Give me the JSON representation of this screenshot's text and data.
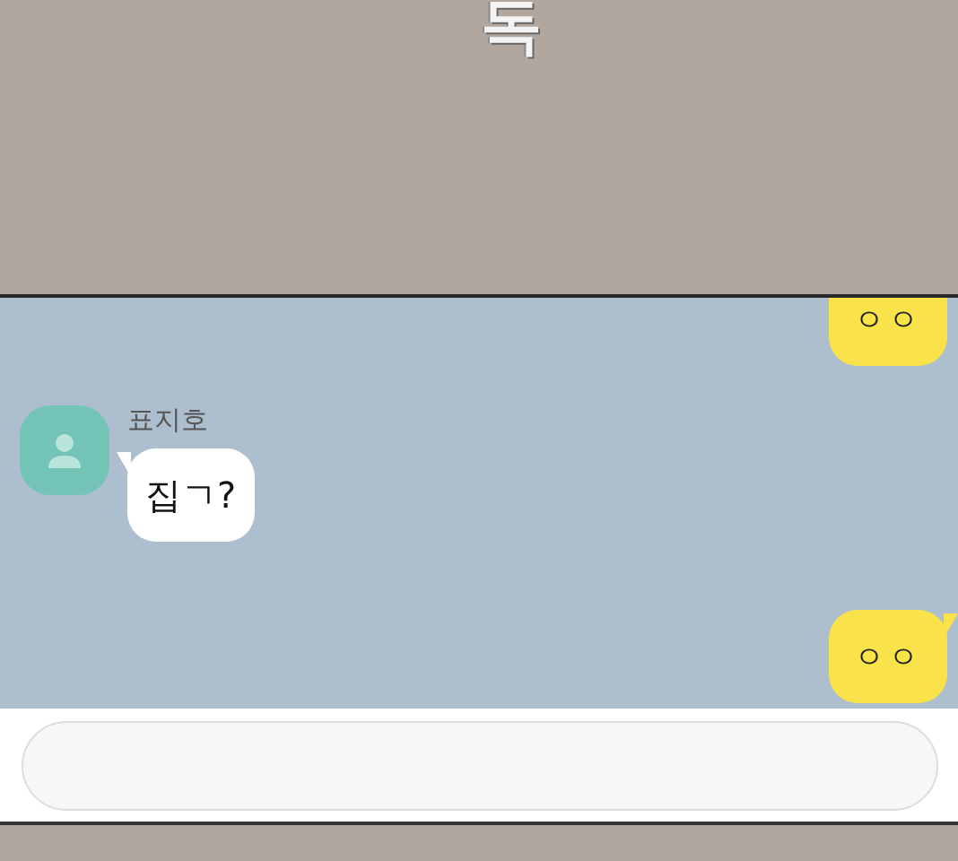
{
  "caption": "독",
  "messages": [
    {
      "kind": "outgoing",
      "text": "ㅇㅇ",
      "tail": false
    },
    {
      "kind": "incoming",
      "sender": "표지호",
      "text": "집ㄱ?",
      "tail": true
    },
    {
      "kind": "outgoing",
      "text": "ㅇㅇ",
      "tail": true
    }
  ],
  "input": {
    "kind": "field"
  }
}
